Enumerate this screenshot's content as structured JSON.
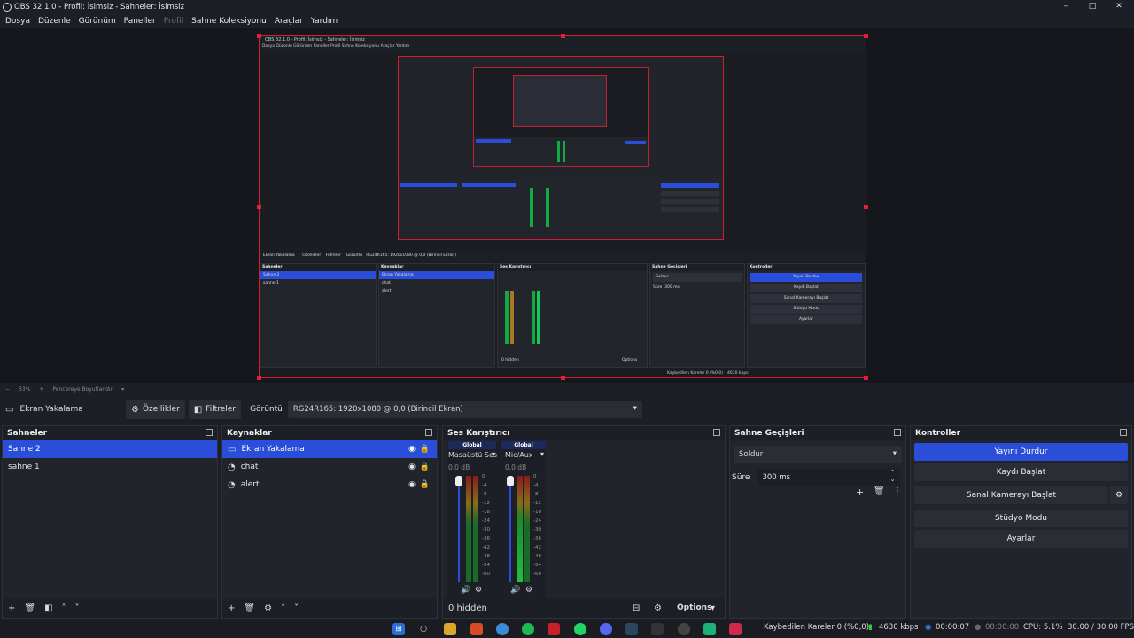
{
  "window": {
    "title": "OBS 32.1.0 - Profil: İsimsiz - Sahneler: İsimsiz",
    "minimize": "–",
    "maximize": "□",
    "close": "✕"
  },
  "menu": [
    "Dosya",
    "Düzenle",
    "Görünüm",
    "Paneller",
    "Profil",
    "Sahne Koleksiyonu",
    "Araçlar",
    "Yardım"
  ],
  "preview": {
    "mini_title": "OBS 32.1.0 - Profil: İsimsiz - Sahneler: İsimsiz",
    "mini_menu": "Dosya  Düzenle  Görünüm  Paneller  Profil  Sahne Koleksiyonu  Araçlar  Yardım",
    "mini_source": "Ekran Yakalama",
    "mini_props": "Özellikler",
    "mini_filters": "Filtreler",
    "mini_display": "Görüntü",
    "mini_display_val": "RG24R165: 1920x1080 @ 0,0 (Birincil Ekran)",
    "mini_scenes_h": "Sahneler",
    "mini_sources_h": "Kaynaklar",
    "mini_mixer_h": "Ses Karıştırıcı",
    "mini_trans_h": "Sahne Geçişleri",
    "mini_ctrl_h": "Kontroller",
    "mini_stop": "Yayını Durdur",
    "mini_rec": "Kaydı Başlat",
    "mini_vcam": "Sanal Kamerayı Başlat",
    "mini_studio": "Stüdyo Modu",
    "mini_settings": "Ayarlar",
    "mini_hidden": "0 hidden",
    "mini_options": "Options",
    "mini_fade": "Soldur",
    "mini_dur_label": "Süre",
    "mini_dur": "300 ms",
    "mini_dropped": "Kaybedilen Kareler 0 (%0,0)",
    "mini_kbps": "4630 kbps"
  },
  "zoom": {
    "level": "33%",
    "fit": "Pencereye Boyutlandır"
  },
  "source_bar": {
    "source_name": "Ekran Yakalama",
    "properties": "Özellikler",
    "filters": "Filtreler",
    "display_label": "Görüntü",
    "display_value": "RG24R165: 1920x1080 @ 0,0 (Birincil Ekran)"
  },
  "scenes": {
    "title": "Sahneler",
    "items": [
      "Sahne 2",
      "sahne 1"
    ]
  },
  "sources": {
    "title": "Kaynaklar",
    "items": [
      "Ekran Yakalama",
      "chat",
      "alert"
    ]
  },
  "mixer": {
    "title": "Ses Karıştırıcı",
    "channels": [
      {
        "global": "Global",
        "name": "Masaüstü Ses",
        "db": "0.0 dB"
      },
      {
        "global": "Global",
        "name": "Mic/Aux",
        "db": "0.0 dB"
      }
    ],
    "scale": [
      "0",
      "-4",
      "-8",
      "-12",
      "-18",
      "-24",
      "-30",
      "-36",
      "-42",
      "-48",
      "-54",
      "-60"
    ],
    "hidden": "0 hidden",
    "options": "Options"
  },
  "transitions": {
    "title": "Sahne Geçişleri",
    "type": "Soldur",
    "duration_label": "Süre",
    "duration": "300 ms"
  },
  "controls": {
    "title": "Kontroller",
    "stop_stream": "Yayını Durdur",
    "start_record": "Kaydı Başlat",
    "start_vcam": "Sanal Kamerayı Başlat",
    "studio_mode": "Stüdyo Modu",
    "settings": "Ayarlar"
  },
  "status": {
    "dropped": "Kaybedilen Kareler 0 (%0,0)",
    "kbps": "4630 kbps",
    "stream_time": "00:00:07",
    "rec_time": "00:00:00",
    "cpu": "CPU: 5.1%",
    "fps": "30.00 / 30.00 FPS"
  },
  "colors": {
    "accent": "#2a4ed9",
    "bounding": "#d02030",
    "bg": "#1d1f26",
    "panel": "#22242b"
  }
}
